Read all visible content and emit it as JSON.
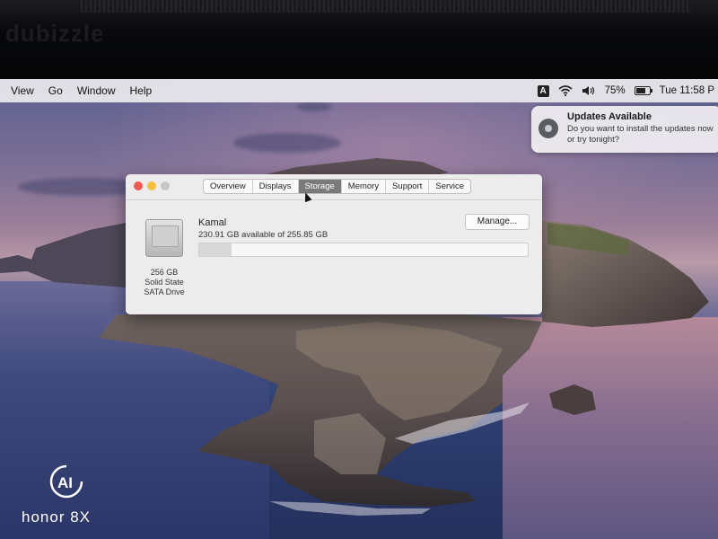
{
  "watermark_top": "dubizzle",
  "menubar": {
    "items": [
      "View",
      "Go",
      "Window",
      "Help"
    ],
    "keyboard_input": "A",
    "wifi_icon": "wifi-icon",
    "volume_icon": "volume-icon",
    "battery_percent": "75%",
    "battery_level": 0.75,
    "clock": "Tue 11:58 P"
  },
  "notification": {
    "icon": "gear-icon",
    "title": "Updates Available",
    "body": "Do you want to install the updates now or try tonight?"
  },
  "about_window": {
    "tabs": [
      "Overview",
      "Displays",
      "Storage",
      "Memory",
      "Support",
      "Service"
    ],
    "active_tab": "Storage",
    "drive_name": "Kamal",
    "available": "230.91 GB available of 255.85 GB",
    "used_fraction": 0.0975,
    "disk": {
      "capacity": "256 GB",
      "type_line1": "Solid State",
      "type_line2": "SATA Drive"
    },
    "manage_button": "Manage..."
  },
  "camera_watermark": {
    "ai_text": "AI",
    "brand": "honor 8X"
  },
  "colors": {
    "close": "#ee5a52",
    "minimize": "#f5be3c",
    "active_tab": "#7a7a7a"
  }
}
